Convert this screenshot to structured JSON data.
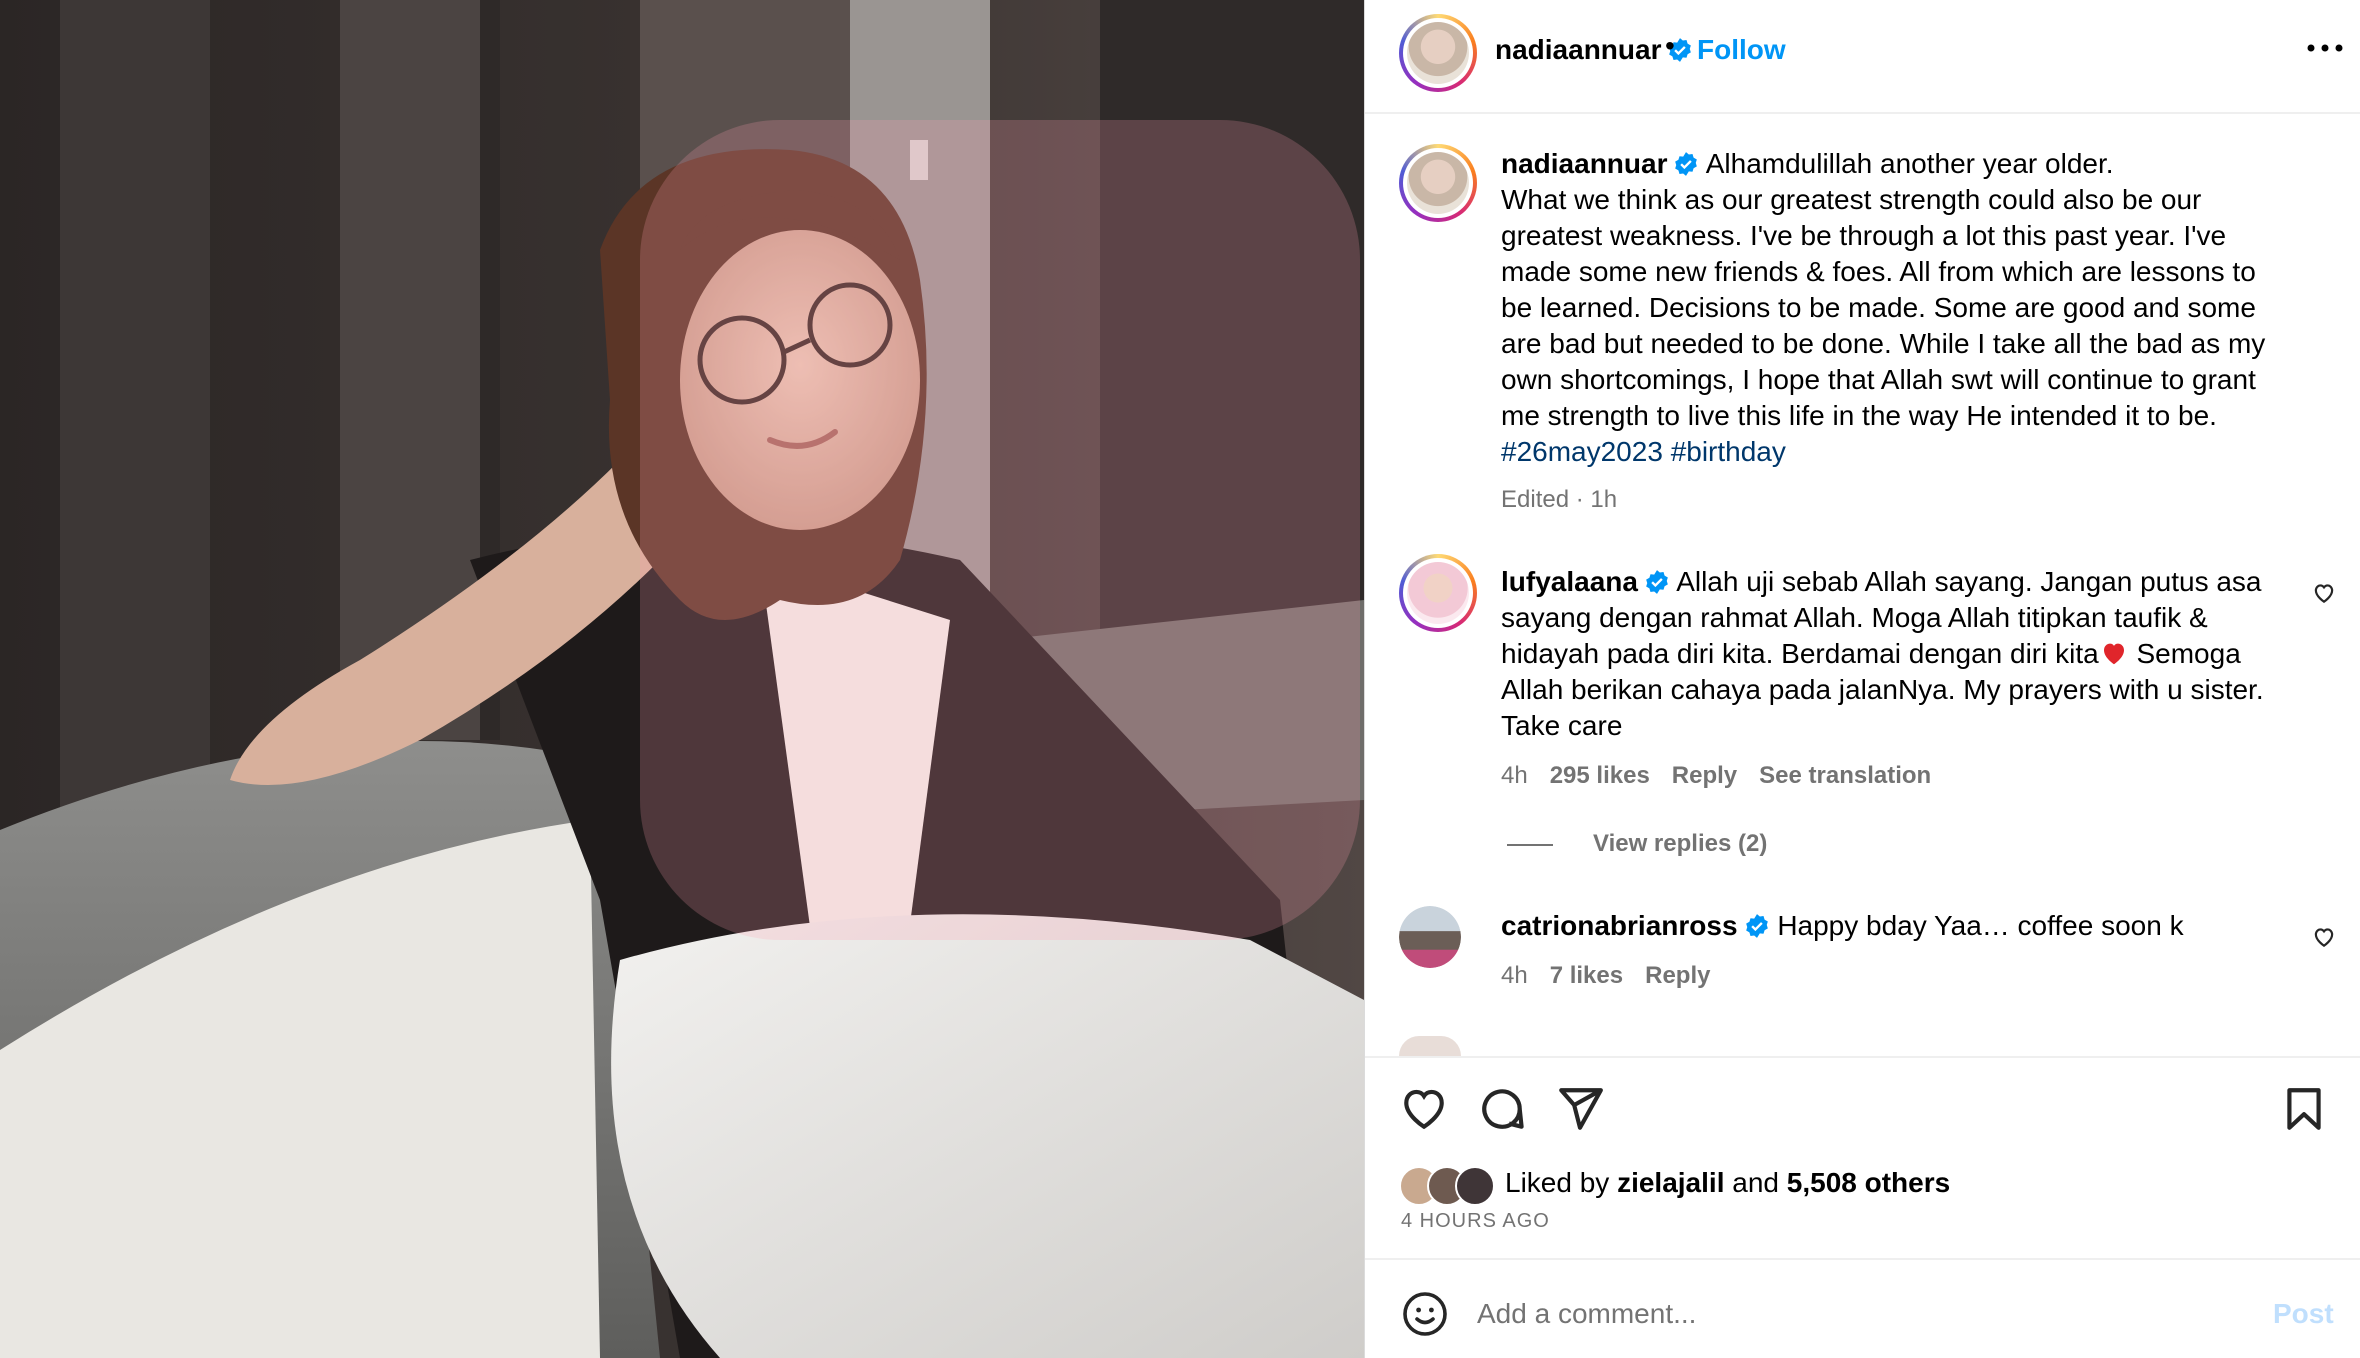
{
  "post": {
    "author": "nadiaannuar",
    "follow_label": "Follow",
    "separator": "•",
    "caption_lines": [
      "What we think as our greatest strength could also be our",
      "greatest weakness. I've be through a lot this past year. I've",
      "made some new friends & foes. All from which are lessons to",
      "be learned. Decisions to be made. Some are good and some",
      "are bad but needed to be done. While I take all the bad as my",
      "own shortcomings, I hope that Allah swt will continue to grant",
      "me strength to live this life in the way He intended it to be."
    ],
    "caption_first": "Alhamdulillah another year older.",
    "hashtags": [
      "#26may2023",
      "#birthday"
    ],
    "caption_meta": "Edited · 1h"
  },
  "comments": [
    {
      "user": "lufyalaana",
      "lines": [
        "Allah uji sebab Allah sayang. Jangan putus asa",
        "sayang dengan rahmat Allah. Moga Allah titipkan taufik &",
        "hidayah pada diri kita. Berdamai dengan diri kita",
        "Allah berikan cahaya pada jalanNya. My prayers with u sister.",
        "Take care"
      ],
      "line3_after_heart": " Semoga",
      "time": "4h",
      "likes": "295 likes",
      "reply": "Reply",
      "translation": "See translation",
      "view_replies": "View replies (2)"
    },
    {
      "user": "catrionabrianross",
      "text": "Happy bday Yaa… coffee soon k",
      "time": "4h",
      "likes": "7 likes",
      "reply": "Reply"
    }
  ],
  "likes": {
    "prefix": "Liked by ",
    "user": "zielajalil",
    "mid": " and ",
    "others": "5,508 others"
  },
  "time_ago": "4 HOURS AGO",
  "comment_box": {
    "placeholder": "Add a comment...",
    "post_label": "Post"
  },
  "colors": {
    "accent": "#0095f6",
    "hashtag": "#00376b",
    "muted": "#737373"
  },
  "icons": [
    "heart-icon",
    "comment-icon",
    "share-icon",
    "bookmark-icon",
    "more-icon",
    "emoji-icon",
    "verified-icon"
  ]
}
